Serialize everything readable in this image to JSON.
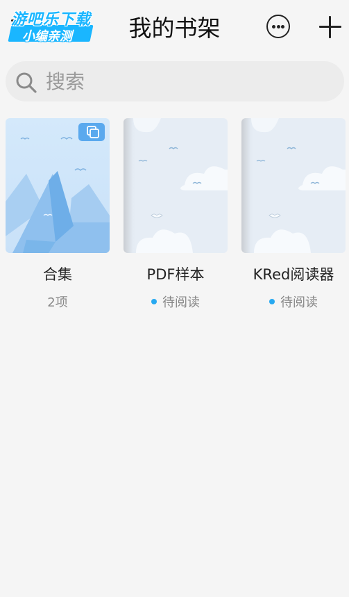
{
  "header": {
    "title": "我的书架",
    "menu_icon": "menu-icon",
    "more_icon": "more-icon",
    "add_icon": "plus-icon"
  },
  "watermark": {
    "line1": "游吧乐下载",
    "line2": "小编亲测"
  },
  "search": {
    "placeholder": "搜索",
    "value": "",
    "icon": "search-icon"
  },
  "shelf": {
    "items": [
      {
        "name": "合集",
        "subtitle": "2项",
        "type": "collection",
        "badge_icon": "collection-icon"
      },
      {
        "name": "PDF样本",
        "subtitle": "待阅读",
        "status_color": "#27a9f1"
      },
      {
        "name": "KRed阅读器",
        "subtitle": "待阅读",
        "status_color": "#27a9f1"
      }
    ]
  },
  "colors": {
    "background": "#f5f5f5",
    "accent": "#27a9f1",
    "cover_blue": "#bcdcf8"
  }
}
